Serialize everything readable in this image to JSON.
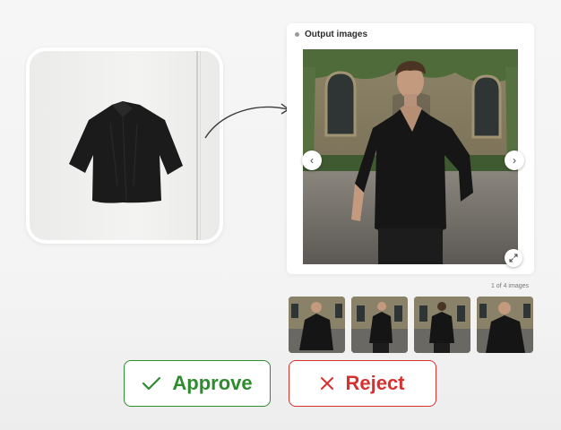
{
  "output": {
    "title": "Output images",
    "counter": "1 of 4 images"
  },
  "icons": {
    "prev": "chevron-left-icon",
    "next": "chevron-right-icon",
    "expand": "expand-icon",
    "approve": "check-icon",
    "reject": "close-icon",
    "arrow": "curved-arrow-icon"
  },
  "actions": {
    "approve_label": "Approve",
    "reject_label": "Reject"
  },
  "colors": {
    "approve": "#2e8b2e",
    "reject": "#d93030"
  }
}
